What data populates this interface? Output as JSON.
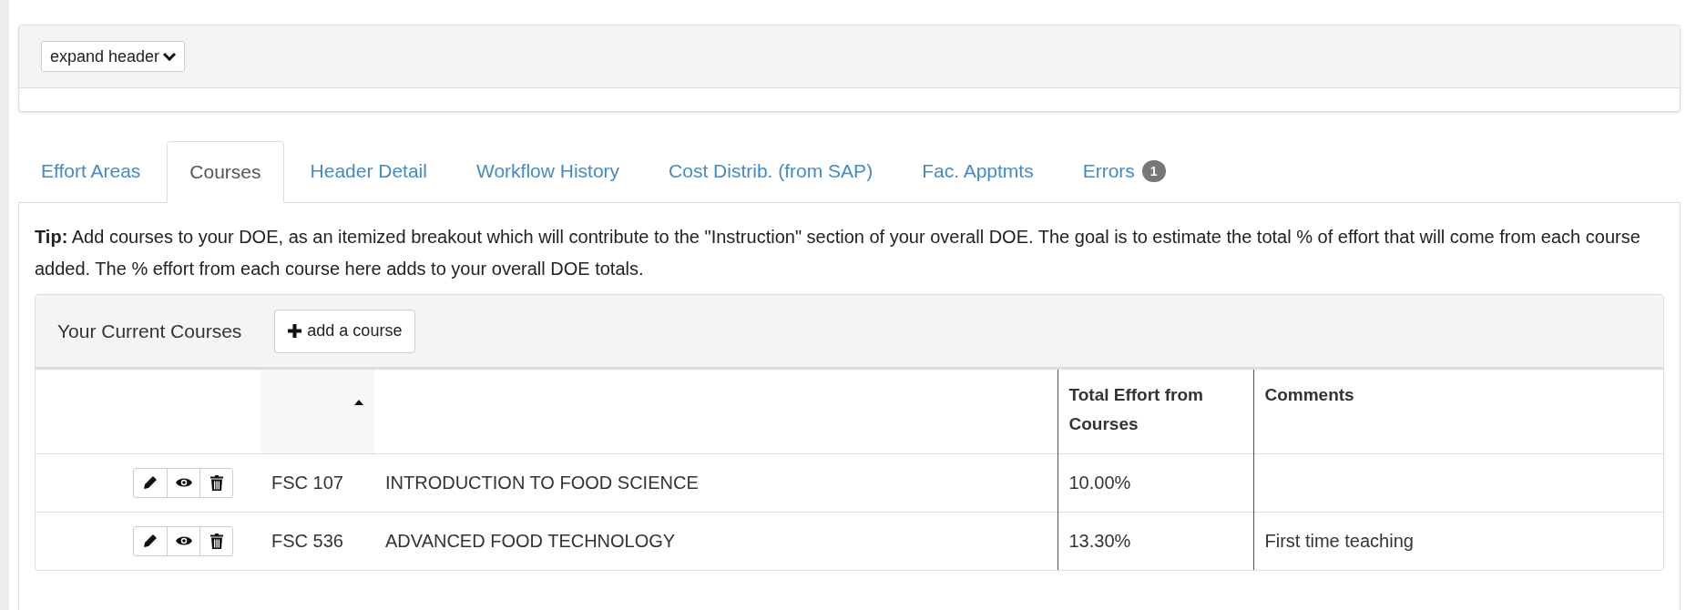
{
  "header": {
    "expand_button": "expand header"
  },
  "tabs": [
    {
      "label": "Effort Areas",
      "selected": false
    },
    {
      "label": "Courses",
      "selected": true
    },
    {
      "label": "Header Detail",
      "selected": false
    },
    {
      "label": "Workflow History",
      "selected": false
    },
    {
      "label": "Cost Distrib. (from SAP)",
      "selected": false
    },
    {
      "label": "Fac. Apptmts",
      "selected": false
    },
    {
      "label": "Errors",
      "badge": "1",
      "selected": false
    }
  ],
  "tip": "**Tip:** Add courses to your DOE, as an itemized breakout which will contribute to the \"Instruction\" section of your overall DOE. The goal is to estimate the total % of effort that will come from each course added. The % effort from each course here adds to your overall DOE totals.",
  "courses_panel": {
    "title": "Your Current Courses",
    "add_button": "add a course"
  },
  "table": {
    "columns": [
      {
        "kind": "actions"
      },
      {
        "kind": "code",
        "sorted": true
      },
      {
        "kind": "title"
      },
      {
        "kind": "text",
        "label": "Total Effort from Courses"
      },
      {
        "kind": "text",
        "label": "Comments"
      }
    ],
    "rows": [
      {
        "code": "FSC 107",
        "title": "INTRODUCTION TO FOOD SCIENCE",
        "effort": "10.00%"
      },
      {
        "code": "FSC 536",
        "title": "ADVANCED FOOD TECHNOLOGY",
        "effort": "13.30%",
        "comment": "First time teaching"
      }
    ]
  }
}
